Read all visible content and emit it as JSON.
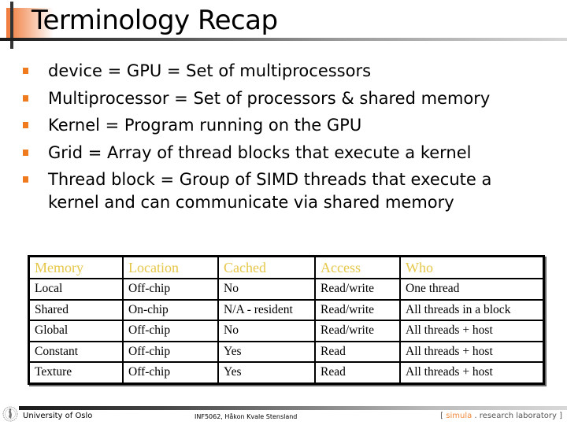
{
  "slide": {
    "title": "Terminology Recap",
    "bullets": [
      {
        "text": "device = GPU = Set of multiprocessors"
      },
      {
        "text": "Multiprocessor = Set of processors & shared memory"
      },
      {
        "text": "Kernel = Program running on the GPU"
      },
      {
        "text": "Grid = Array of thread blocks that execute a kernel"
      },
      {
        "text": "Thread block = Group of SIMD threads that execute a kernel and can communicate via shared memory"
      }
    ]
  },
  "table": {
    "headers": [
      "Memory",
      "Location",
      "Cached",
      "Access",
      "Who"
    ],
    "rows": [
      [
        "Local",
        "Off-chip",
        "No",
        "Read/write",
        "One thread"
      ],
      [
        "Shared",
        "On-chip",
        "N/A - resident",
        "Read/write",
        "All threads in a block"
      ],
      [
        "Global",
        "Off-chip",
        "No",
        "Read/write",
        "All threads + host"
      ],
      [
        "Constant",
        "Off-chip",
        "Yes",
        "Read",
        "All threads + host"
      ],
      [
        "Texture",
        "Off-chip",
        "Yes",
        "Read",
        "All threads + host"
      ]
    ]
  },
  "footer": {
    "logo_icon": "university-seal-icon",
    "university": "University of Oslo",
    "course": "INF5062, Håkon Kvale Stensland",
    "lab_open": "[ ",
    "lab_brand": "simula",
    "lab_rest": " . research laboratory ]"
  },
  "colors": {
    "bullet": "#f07a1e",
    "table_header_text": "#e6c74a",
    "title_accent": "#f07a3a",
    "footer_brand": "#f08a3c"
  }
}
